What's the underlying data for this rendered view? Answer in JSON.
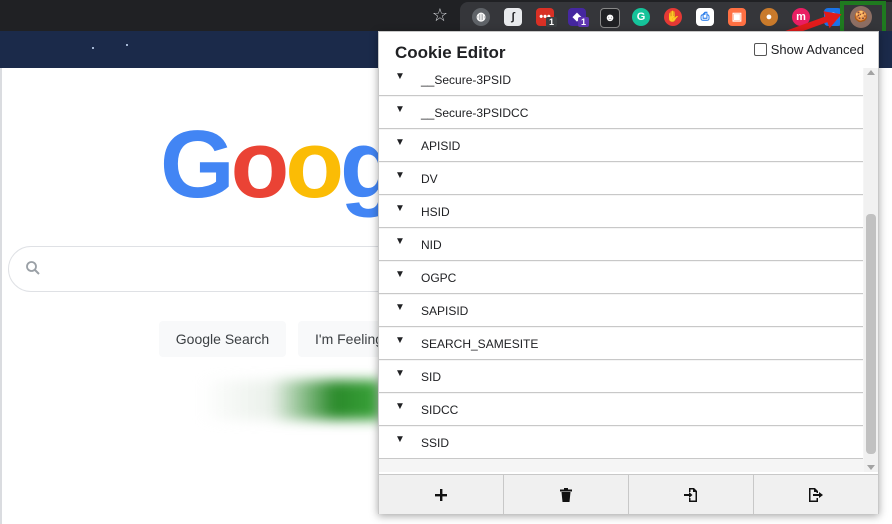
{
  "browser": {
    "extensions": [
      {
        "icon": "globe-icon",
        "color": "#5f6368"
      },
      {
        "icon": "sketch-icon",
        "color": "#e8eaed"
      },
      {
        "icon": "dots-icon",
        "color": "#d93025",
        "badge": "1",
        "badge_color": "#3c4043"
      },
      {
        "icon": "puzzle-icon",
        "color": "#4527a0",
        "badge": "1",
        "badge_color": "#5e35b1"
      },
      {
        "icon": "spy-icon",
        "color": "#202124"
      },
      {
        "icon": "grammarly-icon",
        "color": "#15c39a"
      },
      {
        "icon": "hand-icon",
        "color": "#e53935"
      },
      {
        "icon": "doc-icon",
        "color": "#ffffff"
      },
      {
        "icon": "picture-icon",
        "color": "#ff7043"
      },
      {
        "icon": "cookie-small-icon",
        "color": "#c97a2b"
      },
      {
        "icon": "m-icon",
        "color": "#e91e63"
      },
      {
        "icon": "camera-icon",
        "color": "#1a73e8"
      },
      {
        "icon": "cookie-editor-icon",
        "color": "#8d6e63"
      }
    ]
  },
  "google": {
    "logo_letters": [
      {
        "ch": "G",
        "color": "#4285f4"
      },
      {
        "ch": "o",
        "color": "#ea4335"
      },
      {
        "ch": "o",
        "color": "#fbbc05"
      },
      {
        "ch": "g",
        "color": "#4285f4"
      }
    ],
    "search_button": "Google Search",
    "lucky_button": "I'm Feeling"
  },
  "cookie_editor": {
    "title": "Cookie Editor",
    "show_advanced": "Show Advanced",
    "cookies": [
      "__Secure-3PSID",
      "__Secure-3PSIDCC",
      "APISID",
      "DV",
      "HSID",
      "NID",
      "OGPC",
      "SAPISID",
      "SEARCH_SAMESITE",
      "SID",
      "SIDCC",
      "SSID"
    ],
    "footer_buttons": [
      "add-icon",
      "delete-icon",
      "import-icon",
      "export-icon"
    ]
  }
}
